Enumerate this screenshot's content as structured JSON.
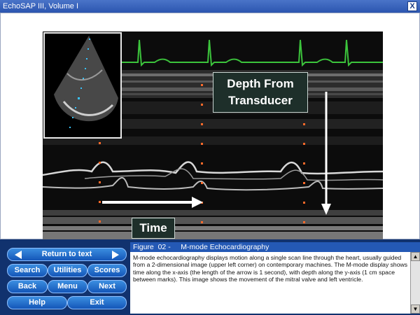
{
  "window": {
    "title": "EchoSAP III, Volume I",
    "close_symbol": "X"
  },
  "figure": {
    "labels": {
      "depth": "Depth From Transducer",
      "time": "Time"
    },
    "colors": {
      "ecg": "#3cc43c",
      "marker": "#ff6a2a",
      "inset_marker": "#39c4ff",
      "arrow": "#ffffff"
    }
  },
  "nav": {
    "return_to_text": "Return to text",
    "search": "Search",
    "utilities": "Utilities",
    "scores": "Scores",
    "back": "Back",
    "menu": "Menu",
    "next": "Next",
    "help": "Help",
    "exit": "Exit"
  },
  "caption": {
    "heading": "Figure  02 -     M-mode Echocardiography",
    "text": "M-mode echocardiography displays motion along a single scan line through the heart, usually guided from a 2-dimensional image (upper left corner) on contemporary machines. The M-mode display shows time along the x-axis (the length of the arrow is 1 second), with depth along the y-axis (1 cm space between marks).  This image shows the movement of the mitral valve and left ventricle."
  },
  "scroll": {
    "up_icon": "scroll-up-arrow-icon",
    "down_icon": "scroll-down-arrow-icon"
  }
}
